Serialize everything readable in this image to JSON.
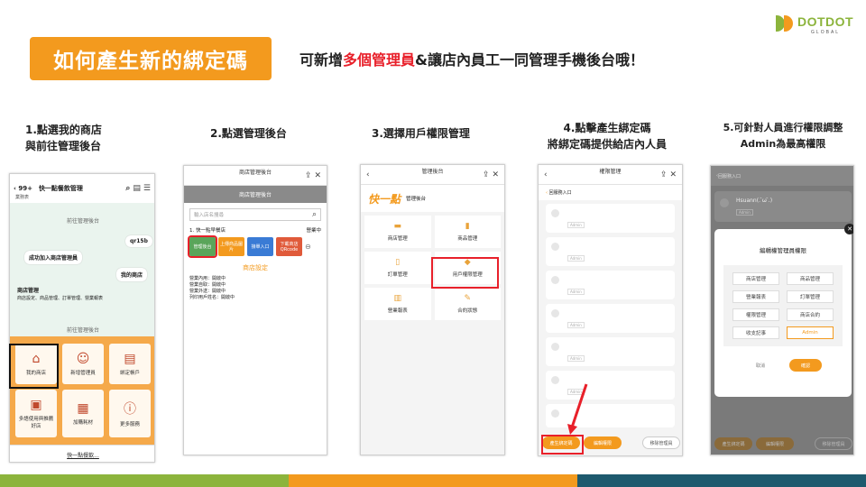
{
  "header": {
    "title": "如何產生新的綁定碼",
    "subtitle_pre": "可新增",
    "subtitle_hl": "多個管理員",
    "subtitle_post": "&讓店內員工一同管理手機後台哦！",
    "logo_word": "DOTDOT",
    "logo_sub": "GLOBAL"
  },
  "steps": [
    {
      "line1": "1.點選我的商店",
      "line2": "與前往管理後台"
    },
    {
      "line1": "2.點選管理後台",
      "line2": ""
    },
    {
      "line1": "3.選擇用戶權限管理",
      "line2": ""
    },
    {
      "line1": "4.點擊產生綁定碼",
      "line2": "將綁定碼提供給店內人員"
    },
    {
      "line1": "5.可針對人員進行權限調整",
      "line2": "Admin為最高權限"
    }
  ],
  "p1": {
    "back": "99+",
    "chat_name": "快一點餐飲管理",
    "chat_sub": "業務表",
    "center1": "前往管理後台",
    "bubble_qr": "qr15b",
    "bubble_join": "成功加入商店管理員",
    "bubble_mystore": "我的商店",
    "mgr_title": "商店管理",
    "mgr_desc": "商店設定、商品管理、訂單管理、營業報表",
    "center2": "前往管理後台",
    "menu": [
      {
        "icon": "store-icon",
        "glyph": "⌂",
        "label": "我的商店"
      },
      {
        "icon": "add-admin-icon",
        "glyph": "☺",
        "label": "新增管理員"
      },
      {
        "icon": "bind-account-icon",
        "glyph": "▤",
        "label": "綁定帳戶"
      },
      {
        "icon": "multi-lang-icon",
        "glyph": "▣",
        "label": "多語使用與推薦好店"
      },
      {
        "icon": "join-material-icon",
        "glyph": "▦",
        "label": "加購耗材"
      },
      {
        "icon": "more-service-icon",
        "glyph": "ⓘ",
        "label": "更多服務"
      }
    ],
    "bottom": "快一點餐飲..."
  },
  "p2": {
    "title": "商店管理後台",
    "gray": "商店管理後台",
    "search_placeholder": "輸入店名搜尋",
    "store": "1. 快一點早餐店",
    "store_status": "營業中",
    "tags": [
      "管理後台",
      "上傳商品圖片",
      "接單入口",
      "下載商店QRcode"
    ],
    "section": "商店設定",
    "info": [
      "營業內用：開啟中",
      "營業自取：開啟中",
      "營業外送：開啟中",
      "列印用戶姓名：開啟中"
    ]
  },
  "p3": {
    "title": "管理後台",
    "brand": "快一點",
    "brand_sub": "管理後台",
    "items": [
      {
        "glyph": "▬",
        "label": "商店管理"
      },
      {
        "glyph": "▮",
        "label": "商品管理"
      },
      {
        "glyph": "▯",
        "label": "訂單管理"
      },
      {
        "glyph": "◆",
        "label": "用戶權限管理"
      },
      {
        "glyph": "▥",
        "label": "營業報表"
      },
      {
        "glyph": "✎",
        "label": "合約狀態"
      }
    ]
  },
  "p4": {
    "title": "權限管理",
    "back_link": "回服務入口",
    "admin_tags": [
      "Admin",
      "Admin",
      "Admin",
      "Admin",
      "Admin",
      "Admin"
    ],
    "btn_gen": "產生綁定碼",
    "btn_edit": "編輯權限",
    "btn_remove": "移除管理員"
  },
  "p5": {
    "back_link": "回服務入口",
    "user": "Hsuann(. ̄ω ̄.)",
    "user_tag": "Admin",
    "dialog_title": "編輯權管理員權限",
    "perms": [
      "商店管理",
      "商品管理",
      "營業報表",
      "訂單管理",
      "權限管理",
      "商店合約",
      "收支記事",
      "Admin"
    ],
    "cancel": "取消",
    "confirm": "確認",
    "btn_gen": "產生綁定碼",
    "btn_edit": "編輯權限",
    "btn_remove": "移除管理員"
  },
  "colors": {
    "orange": "#f39a1e",
    "red": "#e8202a",
    "green": "#8cb43c",
    "teal": "#1e5a6e"
  }
}
